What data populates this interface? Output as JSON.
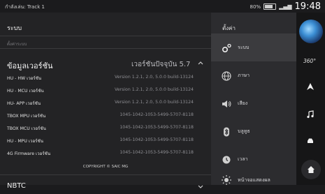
{
  "status": {
    "left_text": "กำลังเล่น: Track 1",
    "battery_percent": "80%",
    "clock": "19:48"
  },
  "main": {
    "title": "ระบบ",
    "section_label": "ตั้งค่าระบบ",
    "version_header": "ข้อมูลเวอร์ชัน",
    "current_version": "เวอร์ชันปัจจุบัน 5.7",
    "rows": [
      {
        "label": "HU - HW เวอร์ชัน",
        "value": "Version 1.2.1, 2.0, 5.0.0 build-13124"
      },
      {
        "label": "HU - MCU เวอร์ชัน",
        "value": "Version 1.2.1, 2.0, 5.0.0 build-13124"
      },
      {
        "label": "HU- APP เวอร์ชัน",
        "value": "Version 1.2.1, 2.0, 5.0.0 build-13124"
      },
      {
        "label": "TBOX MPU เวอร์ชัน",
        "value": "1045-1042-1053-5499-5707-8118"
      },
      {
        "label": "TBOX MCU เวอร์ชัน",
        "value": "1045-1042-1053-5499-5707-8118"
      },
      {
        "label": "HU - MPU เวอร์ชัน",
        "value": "1045-1042-1053-5499-5707-8118"
      },
      {
        "label": "4G Firmware เวอร์ชัน",
        "value": "1045-1042-1053-5499-5707-8118"
      }
    ],
    "copyright": "COPYRIGHT © SAIC MG",
    "nbtc_label": "NBTC"
  },
  "settings": {
    "title": "ตั้งค่า",
    "items": [
      {
        "label": "ระบบ",
        "icon": "gear-icon"
      },
      {
        "label": "ภาษา",
        "icon": "globe-icon"
      },
      {
        "label": "เสียง",
        "icon": "speaker-icon"
      },
      {
        "label": "บลูทูธ",
        "icon": "bluetooth-icon"
      },
      {
        "label": "เวลา",
        "icon": "clock-icon"
      },
      {
        "label": "หน้าจอแสดงผล",
        "icon": "brightness-icon"
      }
    ]
  },
  "rail": {
    "view_label": "360°"
  },
  "colors": {
    "background": "#1b1b1d",
    "panel": "#232325",
    "menu_panel": "#2c2c2f",
    "active_item": "#3b3b3e",
    "accent": "#3b8ed4"
  }
}
